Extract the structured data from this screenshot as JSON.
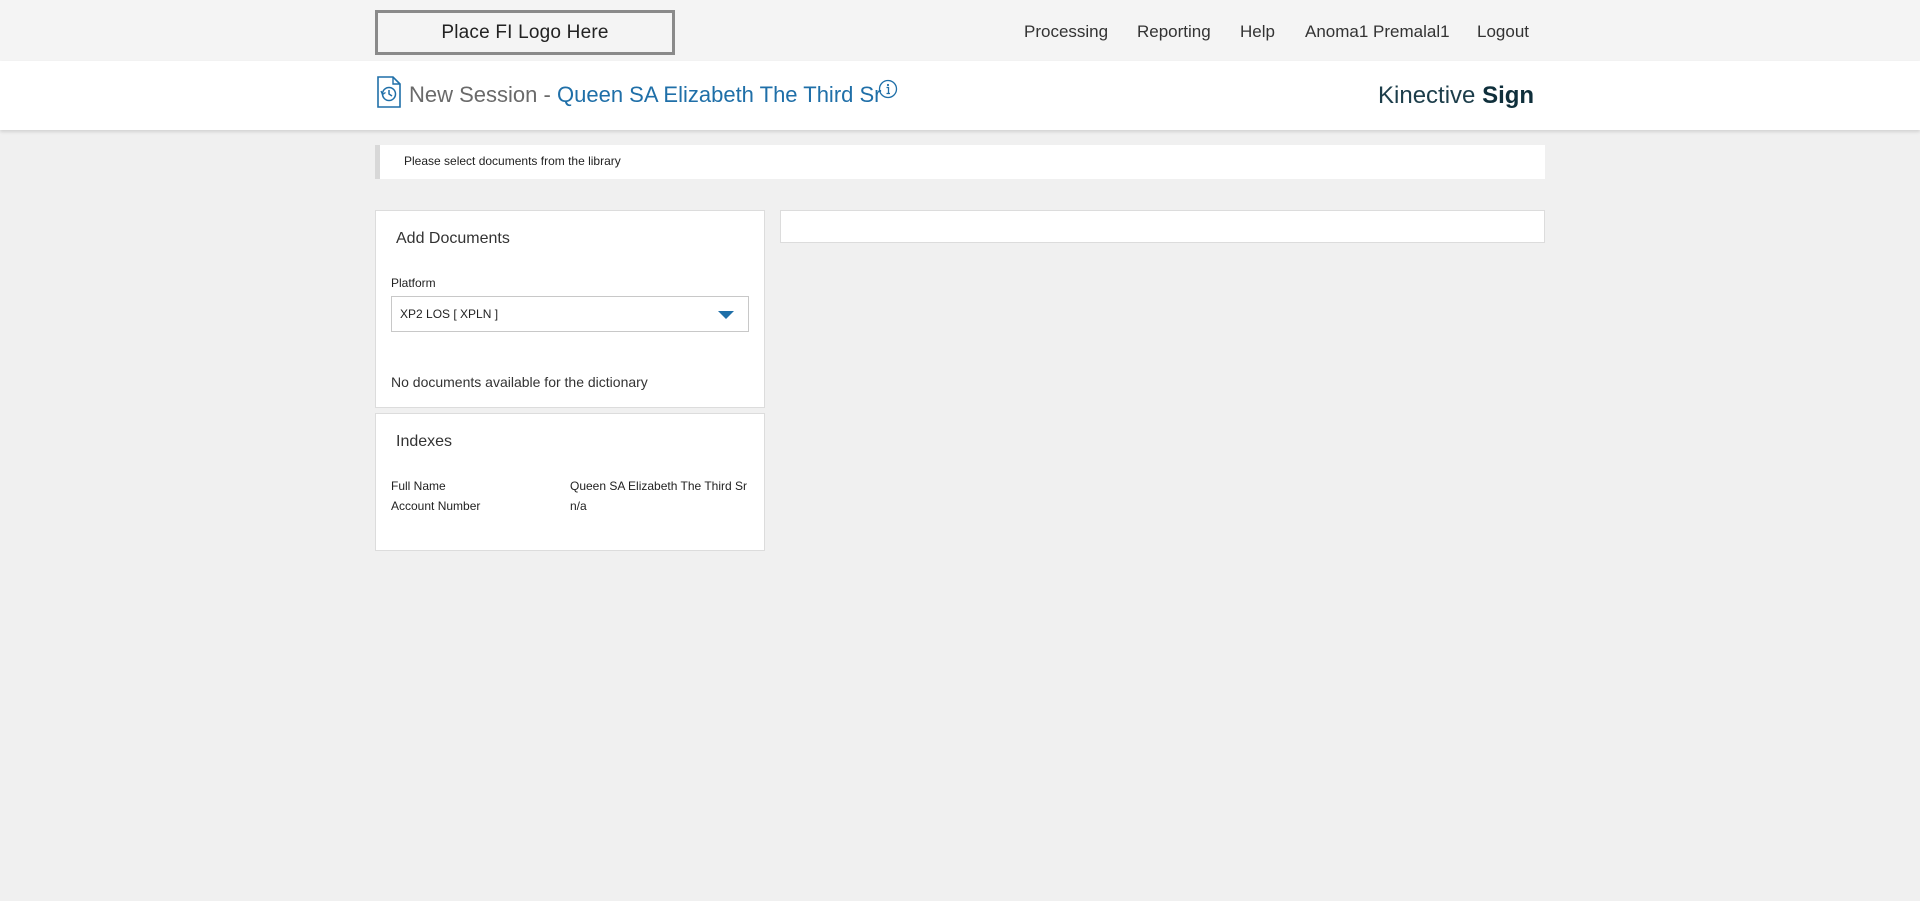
{
  "topbar": {
    "logo_text": "Place FI Logo Here",
    "nav": {
      "processing": "Processing",
      "reporting": "Reporting",
      "help": "Help",
      "user": "Anoma1 Premalal1",
      "logout": "Logout"
    }
  },
  "header": {
    "session_label": "New Session -",
    "session_name": "Queen SA Elizabeth The Third Sr",
    "brand_light": "Kinective",
    "brand_bold": "Sign",
    "icons": {
      "session": "history-document-icon",
      "info": "info-icon"
    },
    "accent_color": "#1f6fa8"
  },
  "notice": {
    "text": "Please select documents from the library"
  },
  "add_documents": {
    "title": "Add Documents",
    "platform_label": "Platform",
    "platform_value": "XP2 LOS [ XPLN ]",
    "empty_message": "No documents available for the dictionary"
  },
  "indexes": {
    "title": "Indexes",
    "rows": [
      {
        "key": "Full Name",
        "value": "Queen SA Elizabeth The Third Sr"
      },
      {
        "key": "Account Number",
        "value": "n/a"
      }
    ]
  }
}
